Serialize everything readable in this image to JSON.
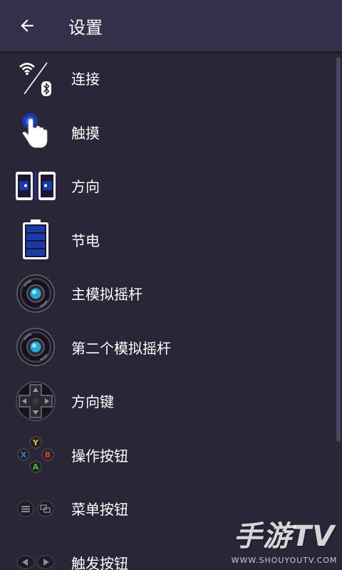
{
  "header": {
    "title": "设置",
    "back_icon": "arrow-left-icon"
  },
  "settings": {
    "items": [
      {
        "label": "连接",
        "icon": "wifi-bluetooth-icon"
      },
      {
        "label": "触摸",
        "icon": "touch-hand-icon"
      },
      {
        "label": "方向",
        "icon": "orientation-icon"
      },
      {
        "label": "节电",
        "icon": "battery-icon"
      },
      {
        "label": "主模拟摇杆",
        "icon": "analog-stick-icon"
      },
      {
        "label": "第二个模拟摇杆",
        "icon": "analog-stick-icon"
      },
      {
        "label": "方向键",
        "icon": "dpad-icon"
      },
      {
        "label": "操作按钮",
        "icon": "action-buttons-icon"
      },
      {
        "label": "菜单按钮",
        "icon": "menu-buttons-icon"
      },
      {
        "label": "触发按钮",
        "icon": "trigger-buttons-icon"
      }
    ]
  },
  "watermark": {
    "logo": "手游TV",
    "url": "WWW.SHOUYOUTV.COM"
  },
  "colors": {
    "background": "#2a2638",
    "appbar": "#35304a",
    "accent_blue": "#1a3aa8",
    "stick_glow": "#2aa8d8"
  }
}
